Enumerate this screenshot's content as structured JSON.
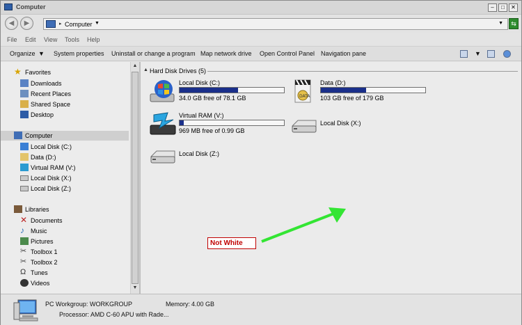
{
  "window": {
    "title": "Computer"
  },
  "address": {
    "crumb": "Computer",
    "separator": "▸"
  },
  "menu": {
    "file": "File",
    "edit": "Edit",
    "view": "View",
    "tools": "Tools",
    "help": "Help"
  },
  "commands": {
    "organize": "Organize",
    "system_properties": "System properties",
    "uninstall": "Uninstall or change a program",
    "map_drive": "Map network drive",
    "control_panel": "Open Control Panel",
    "navigation_pane": "Navigation pane"
  },
  "sidebar": {
    "favorites": "Favorites",
    "downloads": "Downloads",
    "recent": "Recent Places",
    "shared": "Shared Space",
    "desktop": "Desktop",
    "computer": "Computer",
    "local_c": "Local Disk (C:)",
    "data_d": "Data (D:)",
    "vram_v": "Virtual RAM (V:)",
    "local_x": "Local Disk (X:)",
    "local_z": "Local Disk (Z:)",
    "libraries": "Libraries",
    "documents": "Documents",
    "music": "Music",
    "pictures": "Pictures",
    "toolbox1": "Toolbox 1",
    "toolbox2": "Toolbox 2",
    "tunes": "Tunes",
    "videos": "Videos"
  },
  "content": {
    "group_header": "Hard Disk Drives (5)",
    "drives": {
      "c": {
        "name": "Local Disk (C:)",
        "free": "34.0 GB free of 78.1 GB",
        "used_fraction": 0.56
      },
      "d": {
        "name": "Data (D:)",
        "free": "103 GB free of 179 GB",
        "used_fraction": 0.43
      },
      "v": {
        "name": "Virtual RAM (V:)",
        "free": "969 MB free of 0.99 GB",
        "used_fraction": 0.04
      },
      "x": {
        "name": "Local Disk (X:)"
      },
      "z": {
        "name": "Local Disk (Z:)"
      }
    },
    "annotation": "Not White"
  },
  "details": {
    "workgroup_label": "PC  Workgroup:",
    "workgroup_value": "WORKGROUP",
    "memory_label": "Memory:",
    "memory_value": "4.00 GB",
    "processor_label": "Processor:",
    "processor_value": "AMD C-60 APU with Rade..."
  },
  "colors": {
    "accent_bar": "#1a2f8a",
    "annotation_red": "#c00000",
    "arrow_green": "#33e533"
  }
}
